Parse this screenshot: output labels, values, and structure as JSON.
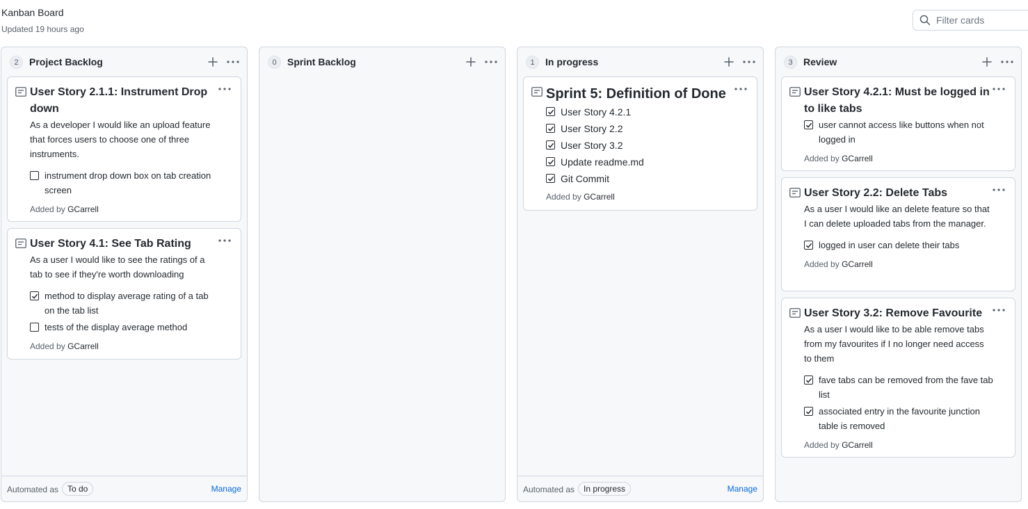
{
  "header": {
    "title": "Kanban Board",
    "updated": "Updated 19 hours ago",
    "filter_placeholder": "Filter cards"
  },
  "added_by_prefix": "Added by",
  "columns": [
    {
      "name": "Project Backlog",
      "count": "2",
      "footer": {
        "label": "Automated as",
        "badge": "To do",
        "manage": "Manage"
      },
      "cards": [
        {
          "title": "User Story 2.1.1: Instrument Drop down",
          "desc": "As a developer I would like an upload feature that forces users to choose one of three instruments.",
          "checks": [
            {
              "text": "instrument drop down box on tab creation screen",
              "checked": false
            }
          ],
          "author": "GCarrell"
        },
        {
          "title": "User Story 4.1: See Tab Rating",
          "desc": "As a user I would like to see the ratings of a tab to see if they're worth downloading",
          "checks": [
            {
              "text": "method to display average rating of a tab on the tab list",
              "checked": true
            },
            {
              "text": "tests of the display average method",
              "checked": false
            }
          ],
          "author": "GCarrell"
        }
      ]
    },
    {
      "name": "Sprint Backlog",
      "count": "0",
      "cards": []
    },
    {
      "name": "In progress",
      "count": "1",
      "footer": {
        "label": "Automated as",
        "badge": "In progress",
        "manage": "Manage"
      },
      "cards": [
        {
          "title": "Sprint 5: Definition of Done",
          "checks": [
            {
              "text": "User Story 4.2.1",
              "checked": true
            },
            {
              "text": "User Story 2.2",
              "checked": true
            },
            {
              "text": "User Story 3.2",
              "checked": true
            },
            {
              "text": "Update readme.md",
              "checked": true
            },
            {
              "text": "Git Commit",
              "checked": true
            }
          ],
          "author": "GCarrell"
        }
      ]
    },
    {
      "name": "Review",
      "count": "3",
      "cards": [
        {
          "title": "User Story 4.2.1: Must be logged in to like tabs",
          "checks": [
            {
              "text": "user cannot access like buttons when not logged in",
              "checked": true
            }
          ],
          "author": "GCarrell"
        },
        {
          "title": "User Story 2.2: Delete Tabs",
          "desc": "As a user I would like an delete feature so that I can delete uploaded tabs from the manager.",
          "checks": [
            {
              "text": "logged in user can delete their tabs",
              "checked": true
            }
          ],
          "author": "GCarrell"
        },
        {
          "title": "User Story 3.2: Remove Favourite",
          "desc": "As a user I would like to be able remove tabs from my favourites if I no longer need access to them",
          "checks": [
            {
              "text": "fave tabs can be removed from the fave tab list",
              "checked": true
            },
            {
              "text": "associated entry in the favourite junction table is removed",
              "checked": true
            }
          ],
          "author": "GCarrell"
        }
      ]
    }
  ]
}
